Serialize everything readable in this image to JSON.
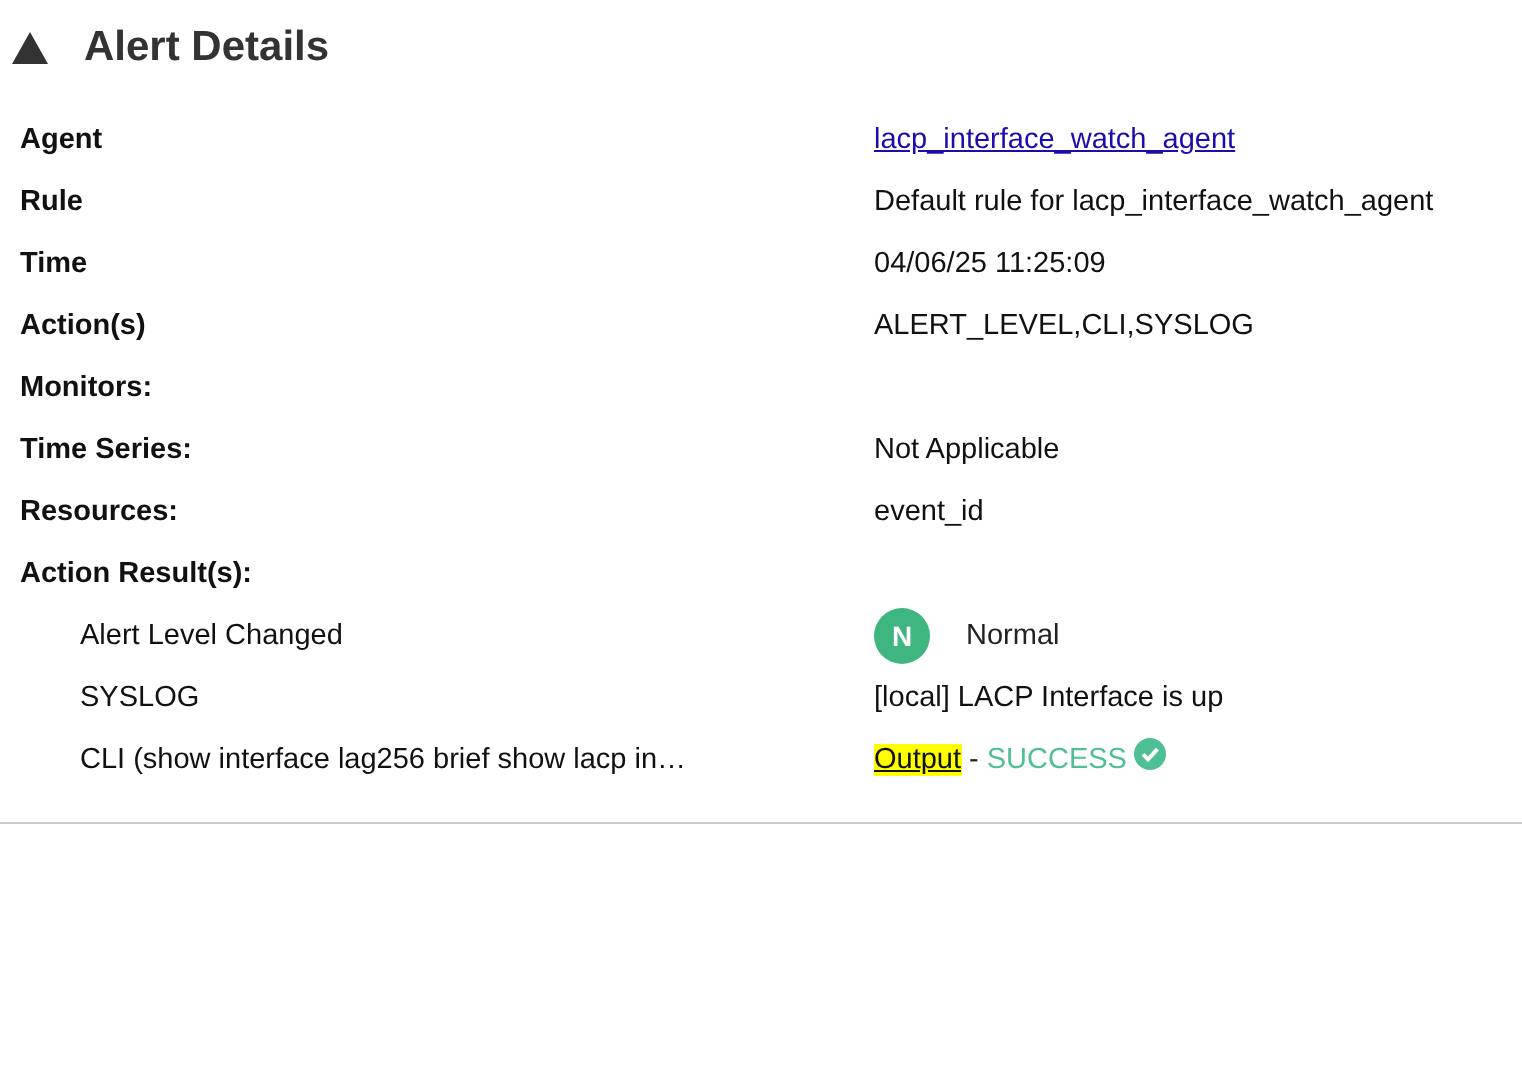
{
  "header": {
    "title": "Alert Details",
    "expanded": true
  },
  "details": [
    {
      "kind": "link",
      "label": "Agent",
      "value": "lacp_interface_watch_agent"
    },
    {
      "kind": "text",
      "label": "Rule",
      "value": "Default rule for lacp_interface_watch_agent"
    },
    {
      "kind": "text",
      "label": "Time",
      "value": "04/06/25 11:25:09"
    },
    {
      "kind": "text",
      "label": "Action(s)",
      "value": "ALERT_LEVEL,CLI,SYSLOG"
    },
    {
      "kind": "section",
      "label": "Monitors:"
    },
    {
      "kind": "section",
      "label": "Time Series:"
    },
    {
      "kind": "value",
      "value": "Not Applicable"
    },
    {
      "kind": "section",
      "label": "Resources:"
    },
    {
      "kind": "value",
      "value": "event_id"
    },
    {
      "kind": "section",
      "label": "Action Result(s):"
    }
  ],
  "results": [
    {
      "kind": "level",
      "label": "Alert Level Changed",
      "badge": "N",
      "color": "#3fb57f",
      "value": "Normal"
    },
    {
      "kind": "text",
      "label": "SYSLOG",
      "value": "[local] LACP Interface is up"
    },
    {
      "kind": "output",
      "label": "CLI (show interface lag256 brief show lacp in…",
      "link": "Output",
      "highlighted": true,
      "separator": "-",
      "status": "SUCCESS"
    }
  ]
}
